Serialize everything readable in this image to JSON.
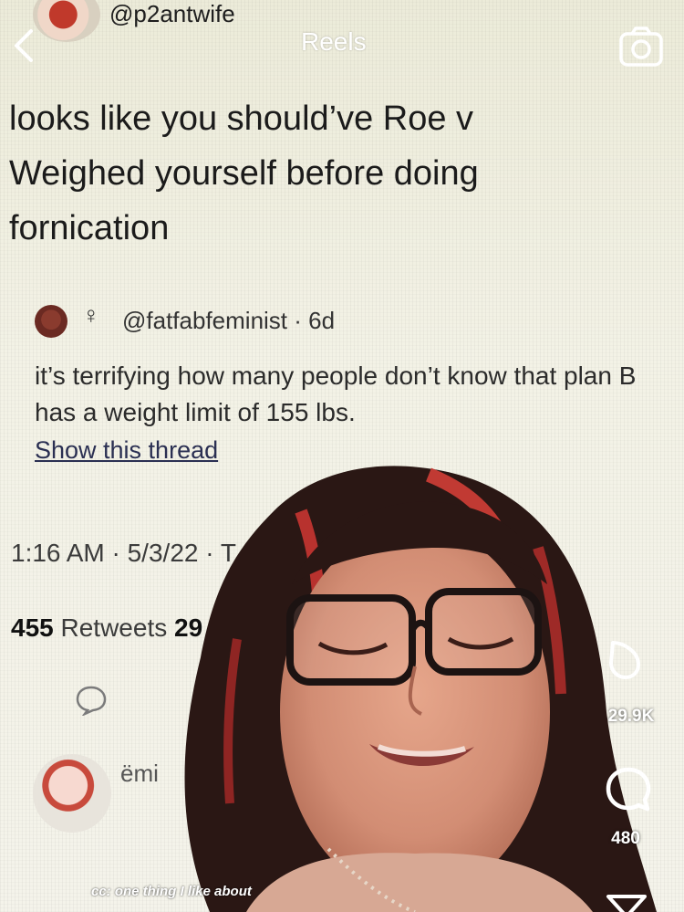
{
  "header": {
    "handle": "@p2antwife",
    "title": "Reels"
  },
  "tweet": {
    "text": "looks like you should’ve Roe v Weighed yourself before doing fornication"
  },
  "quoted": {
    "handle": "@fatfabfeminist · 6d",
    "text": "it’s terrifying how many people don’t know that plan B has a weight limit of 155 lbs.",
    "show_thread": "Show this thread"
  },
  "meta": {
    "timestamp": "1:16 AM · 5/3/22 · T",
    "retweets_count": "455",
    "retweets_label": "Retweets",
    "quote_partial": "29"
  },
  "commenter": {
    "name_partial": "ëmi"
  },
  "actions": {
    "likes": "29.9K",
    "comments": "480"
  },
  "caption": {
    "text": "cc: one thing I like about"
  },
  "icons": [
    "back-icon",
    "camera-icon",
    "venus-icon",
    "reply-icon",
    "like-icon",
    "comment-icon",
    "send-icon"
  ]
}
